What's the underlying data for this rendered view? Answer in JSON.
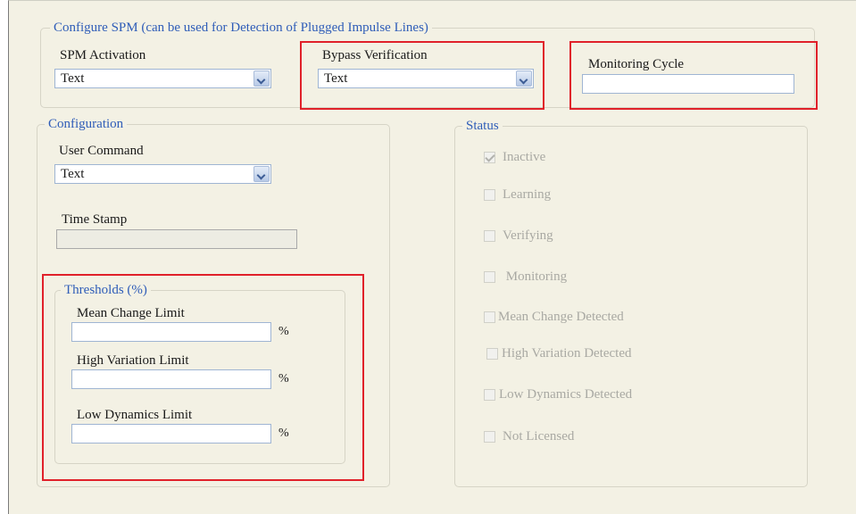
{
  "configure_spm": {
    "legend": "Configure SPM (can be used for Detection of Plugged Impulse Lines)",
    "spm_activation": {
      "label": "SPM Activation",
      "value": "Text"
    },
    "bypass_verification": {
      "label": "Bypass Verification",
      "value": "Text"
    },
    "monitoring_cycle": {
      "label": "Monitoring Cycle",
      "value": ""
    }
  },
  "configuration": {
    "legend": "Configuration",
    "user_command": {
      "label": "User Command",
      "value": "Text"
    },
    "time_stamp": {
      "label": "Time Stamp",
      "value": ""
    }
  },
  "thresholds": {
    "legend": "Thresholds (%)",
    "mean_change": {
      "label": "Mean Change Limit",
      "value": "",
      "unit": "%"
    },
    "high_variation": {
      "label": "High Variation Limit",
      "value": "",
      "unit": "%"
    },
    "low_dynamics": {
      "label": "Low Dynamics Limit",
      "value": "",
      "unit": "%"
    }
  },
  "status": {
    "legend": "Status",
    "items": [
      {
        "label": "Inactive",
        "checked": true
      },
      {
        "label": "Learning",
        "checked": false
      },
      {
        "label": "Verifying",
        "checked": false
      },
      {
        "label": " Monitoring",
        "checked": false
      },
      {
        "label": "Mean Change Detected",
        "checked": false
      },
      {
        "label": "High Variation Detected",
        "checked": false
      },
      {
        "label": "Low Dynamics Detected",
        "checked": false
      },
      {
        "label": "Not Licensed",
        "checked": false
      }
    ]
  },
  "colors": {
    "highlight": "#e0212a",
    "legend": "#2f5db8",
    "panel_bg": "#f3f1e4"
  }
}
